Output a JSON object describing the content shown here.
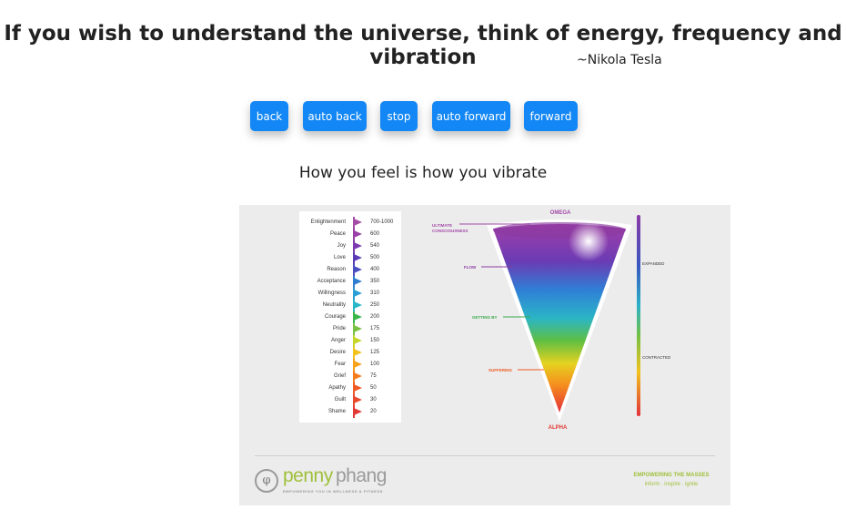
{
  "header": {
    "quote": "If you wish to understand the universe, think of energy, frequency and vibration",
    "author": "~Nikola Tesla"
  },
  "controls": {
    "back": "back",
    "auto_back": "auto back",
    "stop": "stop",
    "auto_forward": "auto forward",
    "forward": "forward"
  },
  "subtitle": "How you feel is how you vibrate",
  "figure": {
    "levels": [
      {
        "label": "Enlightenment",
        "value": "700-1000",
        "color": "#a64ca6"
      },
      {
        "label": "Peace",
        "value": "600",
        "color": "#9b3fa8"
      },
      {
        "label": "Joy",
        "value": "540",
        "color": "#7b3ab0"
      },
      {
        "label": "Love",
        "value": "500",
        "color": "#5a3bb5"
      },
      {
        "label": "Reason",
        "value": "400",
        "color": "#4a4fc0"
      },
      {
        "label": "Acceptance",
        "value": "350",
        "color": "#2f7fd0"
      },
      {
        "label": "Willingness",
        "value": "310",
        "color": "#2a9fd5"
      },
      {
        "label": "Neutrality",
        "value": "250",
        "color": "#29b6c8"
      },
      {
        "label": "Courage",
        "value": "200",
        "color": "#3cb54a"
      },
      {
        "label": "Pride",
        "value": "175",
        "color": "#7ac142"
      },
      {
        "label": "Anger",
        "value": "150",
        "color": "#c6d52a"
      },
      {
        "label": "Desire",
        "value": "125",
        "color": "#f2c21e"
      },
      {
        "label": "Fear",
        "value": "100",
        "color": "#f7a21b"
      },
      {
        "label": "Grief",
        "value": "75",
        "color": "#f57c1f"
      },
      {
        "label": "Apathy",
        "value": "50",
        "color": "#ef5a24"
      },
      {
        "label": "Guilt",
        "value": "30",
        "color": "#e94a2d"
      },
      {
        "label": "Shame",
        "value": "20",
        "color": "#e23a36"
      }
    ],
    "cone_labels": {
      "top": "OMEGA",
      "bottom": "ALPHA",
      "ultimate_1": "ULTIMATE",
      "ultimate_2": "CONSCIOUSNESS",
      "flow": "FLOW",
      "getting_by": "GETTING BY",
      "suffering": "SUFFERING",
      "expanded": "EXPANDED",
      "contracted": "CONTRACTED"
    },
    "branding": {
      "name_part1": "penny",
      "name_part2": "phang",
      "tagline": "EMPOWERING YOU IN WELLNESS & FITNESS",
      "slogan": "EMPOWERING THE MASSES",
      "sub_slogan": "inform . inspire . ignite"
    },
    "colors": {
      "button": "#1287f5",
      "brand_green": "#9fc03a"
    }
  }
}
